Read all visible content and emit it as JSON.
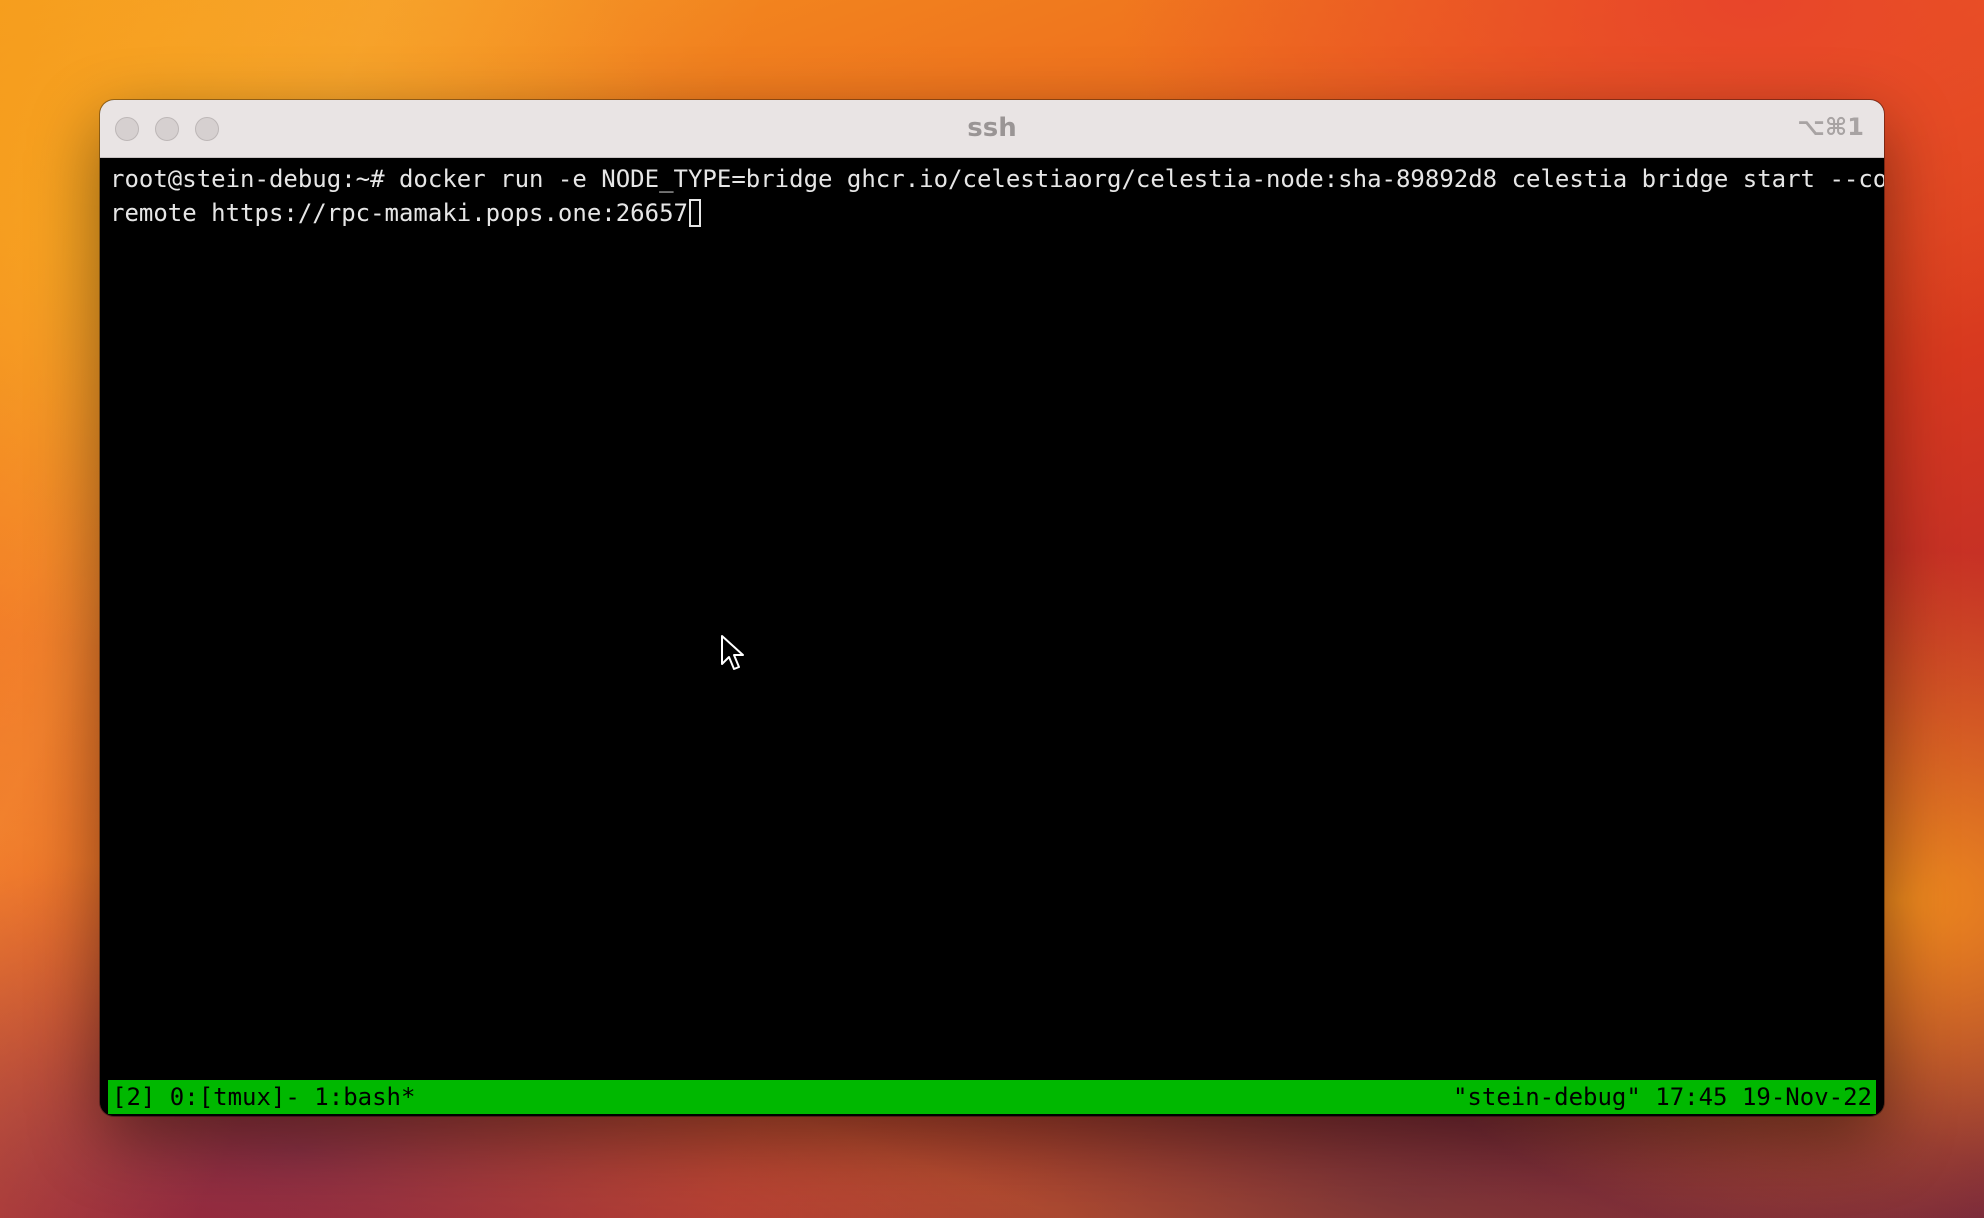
{
  "window": {
    "title": "ssh",
    "shortcut": "⌥⌘1"
  },
  "terminal": {
    "lines": [
      "root@stein-debug:~# docker run -e NODE_TYPE=bridge ghcr.io/celestiaorg/celestia-node:sha-89892d8 celestia bridge start --core.",
      "remote https://rpc-mamaki.pops.one:26657"
    ]
  },
  "tmux_status": {
    "left": "[2] 0:[tmux]- 1:bash*",
    "right": "\"stein-debug\" 17:45 19-Nov-22"
  },
  "colors": {
    "status_bar": "#00b800",
    "terminal_bg": "#000000",
    "terminal_fg": "#e6e6e6"
  },
  "icons": [
    "close-button-icon",
    "minimize-button-icon",
    "maximize-button-icon",
    "mouse-pointer-icon"
  ]
}
